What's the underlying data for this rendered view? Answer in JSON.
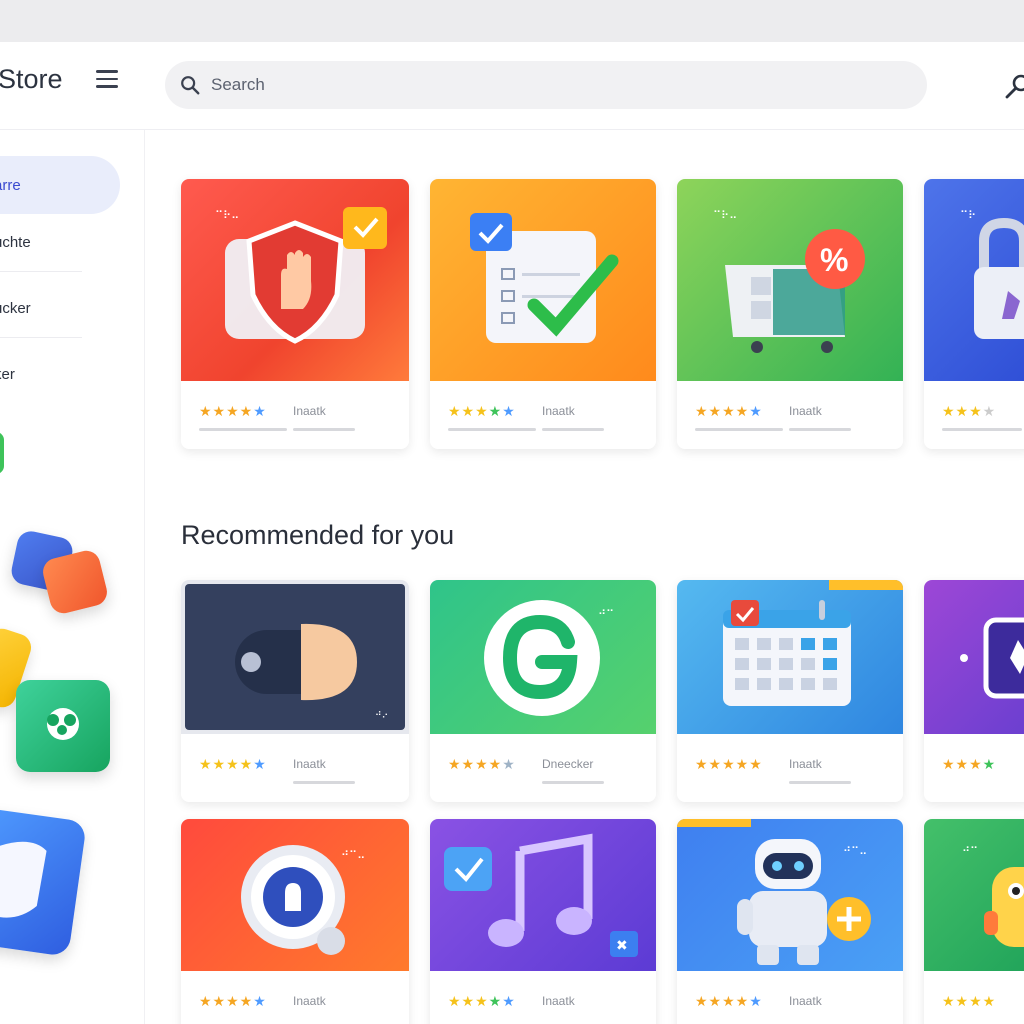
{
  "header": {
    "title": "Store",
    "search_placeholder": "Search"
  },
  "sidebar": {
    "items": [
      {
        "label": "arre"
      },
      {
        "label": "uchte"
      },
      {
        "label": "ucker"
      },
      {
        "label": "ker"
      }
    ]
  },
  "featured": [
    {
      "name": "shield-app",
      "tag": "Inaatk",
      "rating": 4.5
    },
    {
      "name": "checklist-app",
      "tag": "Inaatk",
      "rating": 4.5
    },
    {
      "name": "shopping-app",
      "tag": "Inaatk",
      "rating": 4.5
    },
    {
      "name": "lock-app",
      "tag": "Inaatk",
      "rating": 4.5
    }
  ],
  "recommended": {
    "heading": "Recommended for you",
    "row1": [
      {
        "name": "toggle-app",
        "tag": "Inaatk",
        "rating": 4.5
      },
      {
        "name": "grammar-app",
        "tag": "Dneecker",
        "rating": 4.5
      },
      {
        "name": "calendar-app",
        "tag": "Inaatk",
        "rating": 5
      },
      {
        "name": "purple-app",
        "tag": "Inaatk",
        "rating": 4.5
      }
    ],
    "row2": [
      {
        "name": "vpn-app",
        "tag": "Inaatk",
        "rating": 4.5
      },
      {
        "name": "music-app",
        "tag": "Inaatk",
        "rating": 4.5
      },
      {
        "name": "robot-app",
        "tag": "Inaatk",
        "rating": 4.5
      },
      {
        "name": "creature-app",
        "tag": "Inaatk",
        "rating": 4.5
      }
    ]
  },
  "colors": {
    "accent": "#3a4ad0",
    "star": "#f5a623"
  }
}
